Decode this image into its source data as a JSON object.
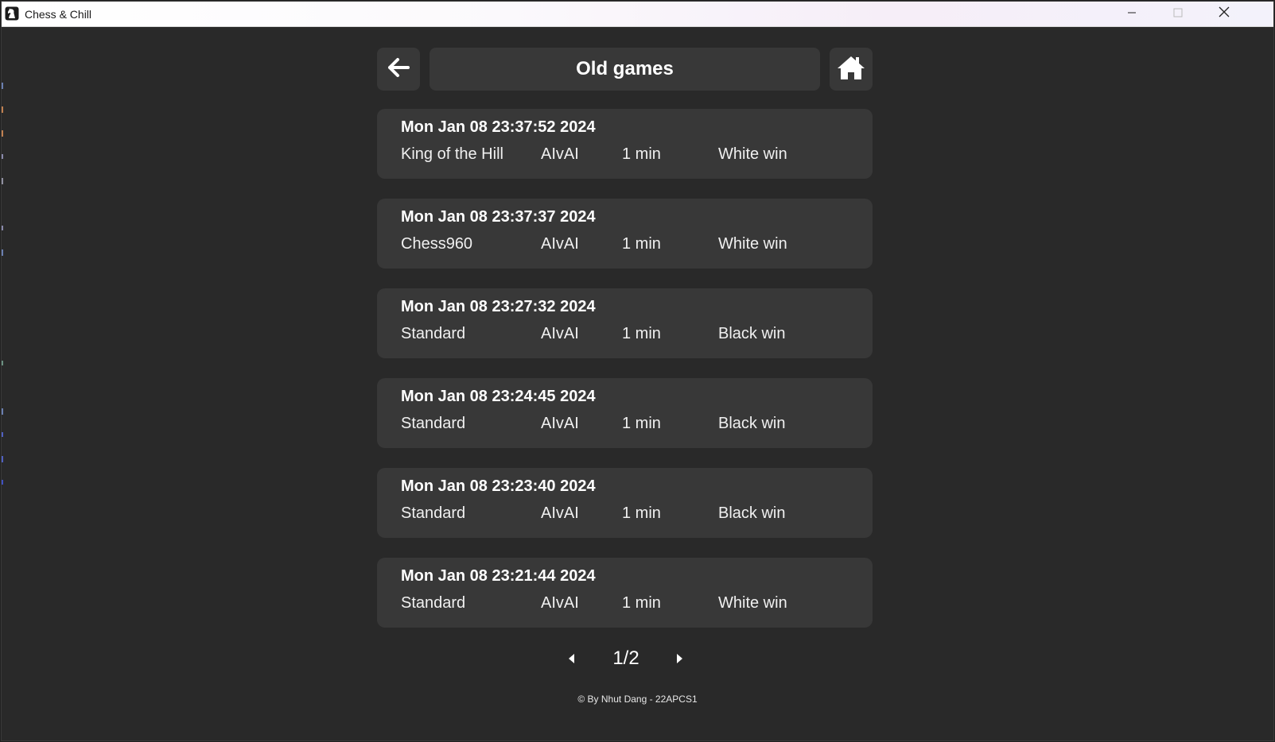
{
  "window": {
    "title": "Chess & Chill",
    "icon": "chess-knight-icon",
    "controls": [
      "minimize-icon",
      "maximize-icon",
      "close-icon"
    ]
  },
  "header": {
    "title": "Old games",
    "back_icon": "arrow-left-icon",
    "home_icon": "home-icon"
  },
  "games": [
    {
      "date": "Mon Jan 08 23:37:52 2024",
      "variant": "King of the Hill",
      "mode": "AIvAI",
      "time": "1 min",
      "result": "White win"
    },
    {
      "date": "Mon Jan 08 23:37:37 2024",
      "variant": "Chess960",
      "mode": "AIvAI",
      "time": "1 min",
      "result": "White win"
    },
    {
      "date": "Mon Jan 08 23:27:32 2024",
      "variant": "Standard",
      "mode": "AIvAI",
      "time": "1 min",
      "result": "Black win"
    },
    {
      "date": "Mon Jan 08 23:24:45 2024",
      "variant": "Standard",
      "mode": "AIvAI",
      "time": "1 min",
      "result": "Black win"
    },
    {
      "date": "Mon Jan 08 23:23:40 2024",
      "variant": "Standard",
      "mode": "AIvAI",
      "time": "1 min",
      "result": "Black win"
    },
    {
      "date": "Mon Jan 08 23:21:44 2024",
      "variant": "Standard",
      "mode": "AIvAI",
      "time": "1 min",
      "result": "White win"
    }
  ],
  "pagination": {
    "text": "1/2",
    "current": 1,
    "total": 2,
    "prev_icon": "caret-left-icon",
    "next_icon": "caret-right-icon"
  },
  "footer": {
    "text": "© By Nhut Dang - 22APCS1"
  },
  "colors": {
    "background": "#292929",
    "card": "#383838",
    "text": "#ffffff"
  }
}
